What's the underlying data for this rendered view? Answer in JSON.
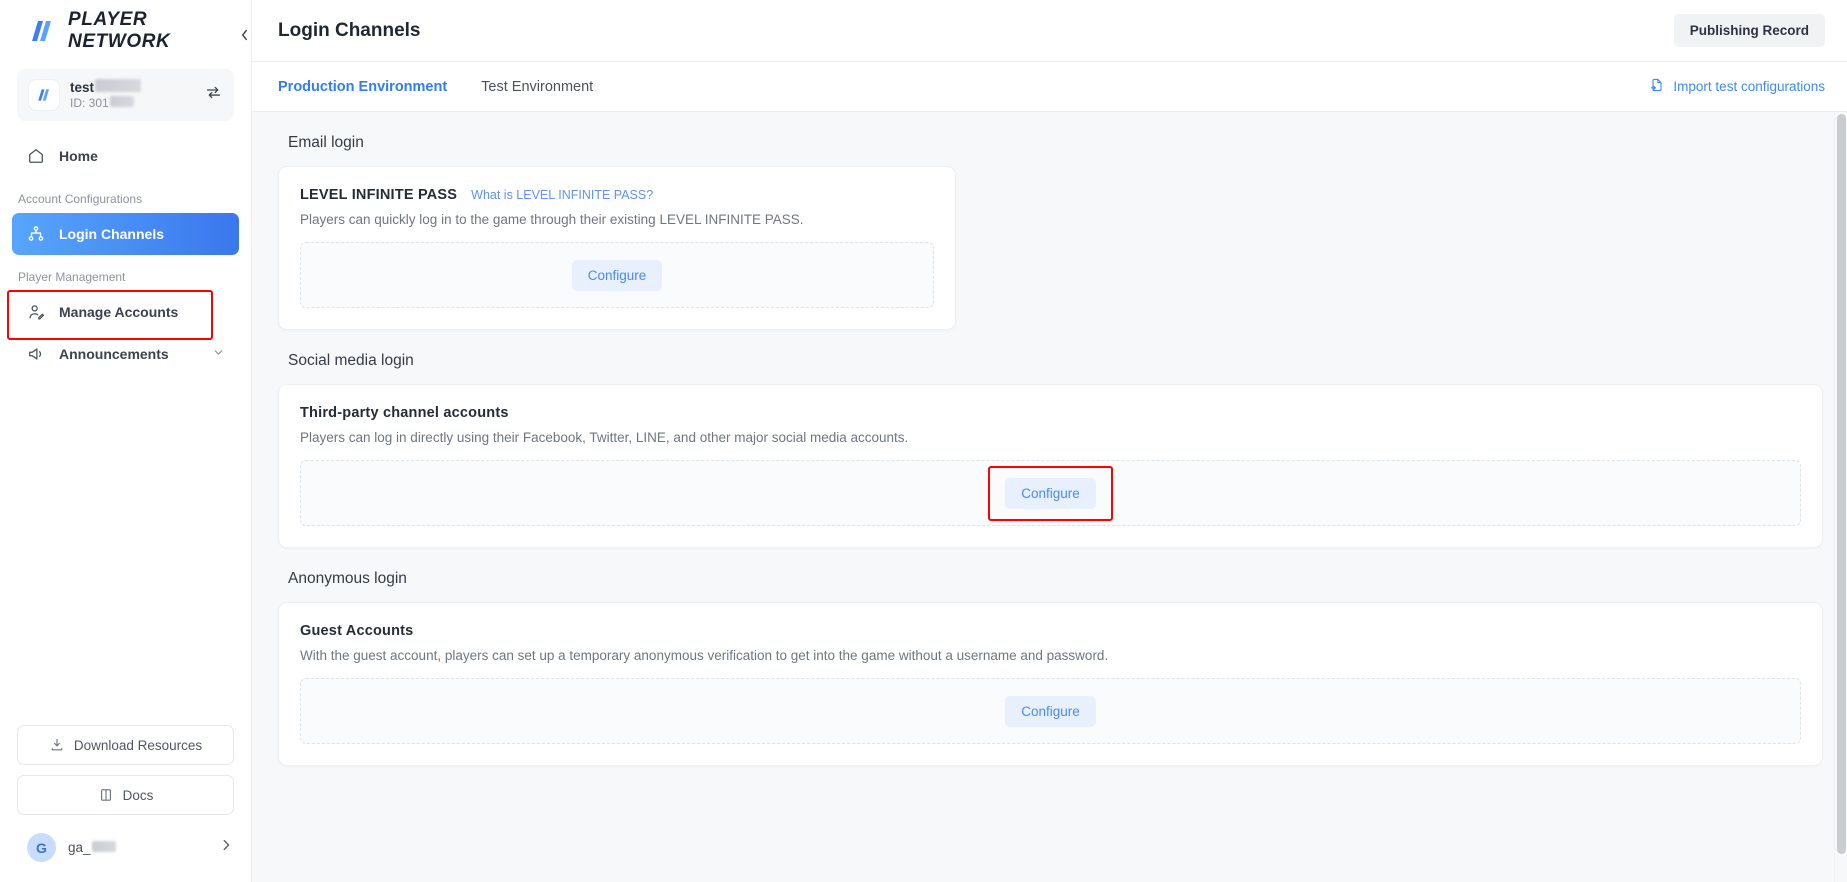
{
  "brand": {
    "name": "PLAYER NETWORK",
    "logo_icon": "player-network-logo-icon"
  },
  "project": {
    "name": "test",
    "id_label": "ID: 301",
    "switch_icon": "swap-project-icon",
    "logo_icon": "project-logo-icon"
  },
  "sidebar": {
    "items": [
      {
        "label": "Home",
        "icon": "home-icon",
        "active": false
      },
      {
        "label": "Login Channels",
        "icon": "sitemap-icon",
        "active": true
      },
      {
        "label": "Manage Accounts",
        "icon": "user-edit-icon",
        "active": false
      },
      {
        "label": "Announcements",
        "icon": "megaphone-icon",
        "active": false
      }
    ],
    "groups": [
      {
        "label": "Account Configurations"
      },
      {
        "label": "Player Management"
      }
    ],
    "download_button": {
      "label": "Download Resources",
      "icon": "download-icon"
    },
    "docs_button": {
      "label": "Docs",
      "icon": "book-icon"
    },
    "user": {
      "avatar_initial": "G",
      "name": "ga_",
      "chevron_icon": "chevron-right-icon"
    },
    "collapse_icon": "collapse-sidebar-icon"
  },
  "header": {
    "title": "Login Channels",
    "publishing_record_label": "Publishing Record"
  },
  "tabbar": {
    "tabs": [
      {
        "label": "Production Environment",
        "active": true
      },
      {
        "label": "Test Environment",
        "active": false
      }
    ],
    "import_link": {
      "label": "Import test configurations",
      "icon": "import-file-icon"
    }
  },
  "sections": [
    {
      "title": "Email login",
      "card": {
        "title": "LEVEL INFINITE PASS",
        "link": "What is LEVEL INFINITE PASS?",
        "description": "Players can quickly log in to the game through their existing LEVEL INFINITE PASS.",
        "configure_label": "Configure",
        "highlighted": false
      }
    },
    {
      "title": "Social media login",
      "card": {
        "title": "Third-party channel accounts",
        "link": "",
        "description": "Players can log in directly using their Facebook, Twitter, LINE, and other major social media accounts.",
        "configure_label": "Configure",
        "highlighted": true
      }
    },
    {
      "title": "Anonymous login",
      "card": {
        "title": "Guest Accounts",
        "link": "",
        "description": "With the guest account, players can set up a temporary anonymous verification to get into the game without a username and password.",
        "configure_label": "Configure",
        "highlighted": false
      }
    }
  ],
  "colors": {
    "accent_blue": "#2f7df6",
    "nav_active_gradient_start": "#57a5fb",
    "nav_active_gradient_end": "#3a77ee",
    "highlight_red": "#ff0000",
    "configure_bg": "#e8f0fe",
    "page_bg": "#f7f8fa"
  }
}
